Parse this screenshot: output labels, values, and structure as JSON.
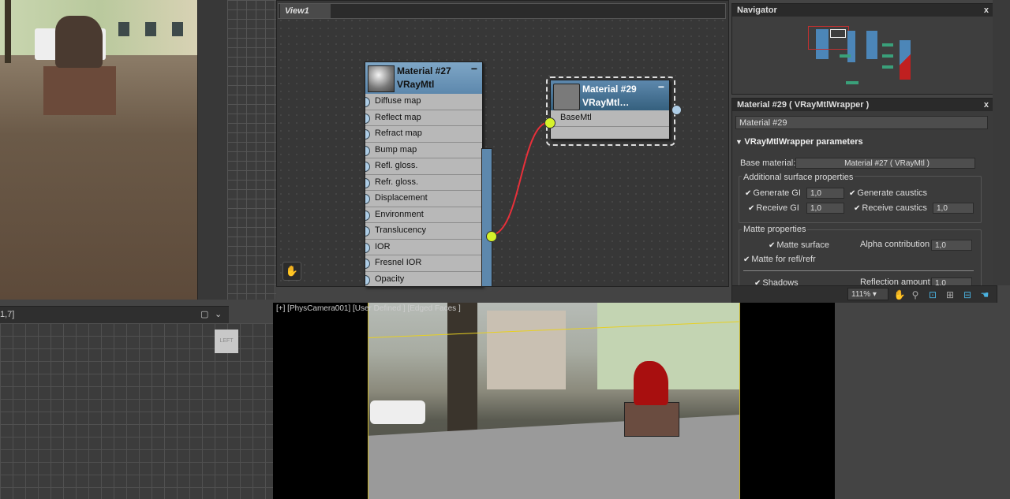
{
  "left_strip": {
    "coord_text": "1,7]"
  },
  "slate": {
    "view_tab": "View1"
  },
  "node27": {
    "title": "Material #27",
    "subtitle": "VRayMtl",
    "slots": [
      "Diffuse map",
      "Reflect map",
      "Refract map",
      "Bump map",
      "Refl. gloss.",
      "Refr. gloss.",
      "Displacement",
      "Environment",
      "Translucency",
      "IOR",
      "Fresnel IOR",
      "Opacity"
    ]
  },
  "node29": {
    "title": "Material #29",
    "subtitle": "VRayMtl…",
    "slot": "BaseMtl"
  },
  "navigator": {
    "title": "Navigator",
    "close": "x"
  },
  "params": {
    "title": "Material #29  ( VRayMtlWrapper )",
    "close": "x",
    "name_value": "Material #29",
    "rollout_title": "VRayMtlWrapper parameters",
    "base_material_label": "Base material:",
    "base_material_value": "Material #27  ( VRayMtl )",
    "additional_group": "Additional surface properties",
    "generate_gi_label": "Generate GI",
    "generate_gi_value": "1,0",
    "generate_caustics_label": "Generate caustics",
    "receive_gi_label": "Receive GI",
    "receive_gi_value": "1,0",
    "receive_caustics_label": "Receive caustics",
    "receive_caustics_value": "1,0",
    "matte_group": "Matte properties",
    "matte_surface_label": "Matte surface",
    "alpha_contribution_label": "Alpha contribution",
    "alpha_contribution_value": "1,0",
    "matte_refl_label": "Matte for refl/refr",
    "shadows_label": "Shadows",
    "reflection_amount_label": "Reflection amount",
    "reflection_amount_value": "1,0"
  },
  "statusbar": {
    "zoom": "111%"
  },
  "viewport": {
    "label": "[+] [PhysCamera001] [User Defined ] [Edged Faces ]"
  },
  "colors": {
    "wire": "#e8303a",
    "socket_active": "#d6f22a",
    "node_header": "#5d88ad"
  }
}
